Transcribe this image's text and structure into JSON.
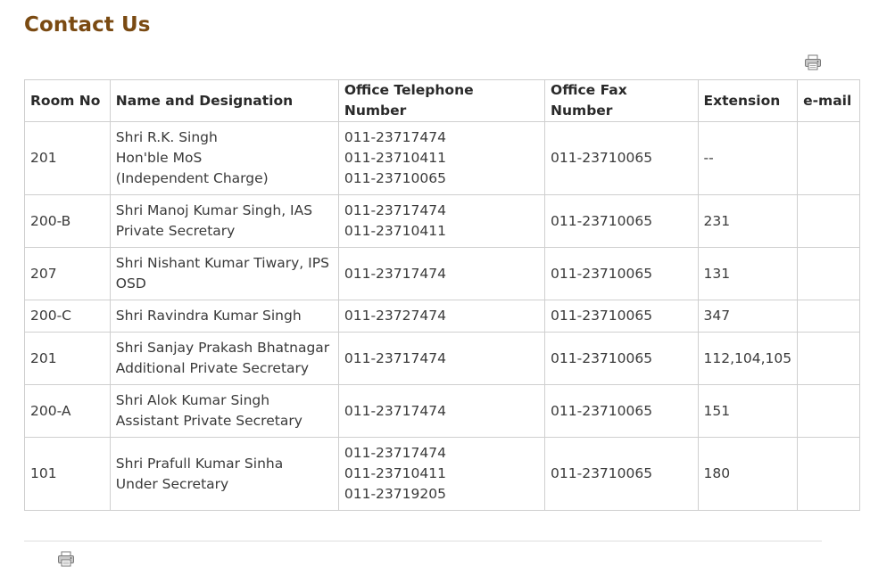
{
  "page": {
    "title": "Contact Us"
  },
  "icons": {
    "print_top": "print-icon",
    "print_bottom": "print-icon"
  },
  "table": {
    "headers": [
      "Room No",
      "Name and Designation",
      "Office Telephone Number",
      "Office Fax Number",
      "Extension",
      "e-mail"
    ],
    "rows": [
      {
        "room": "201",
        "name_lines": [
          "Shri R.K. Singh",
          "Hon'ble MoS",
          "(Independent Charge)"
        ],
        "phones": [
          "011-23717474",
          "011-23710411",
          "011-23710065"
        ],
        "fax": "011-23710065",
        "extension": "--",
        "email": ""
      },
      {
        "room": "200-B",
        "name_lines": [
          "Shri Manoj Kumar Singh, IAS",
          "Private Secretary"
        ],
        "phones": [
          "011-23717474",
          "011-23710411"
        ],
        "fax": "011-23710065",
        "extension": "231",
        "email": ""
      },
      {
        "room": "207",
        "name_lines": [
          "Shri Nishant Kumar Tiwary, IPS",
          "OSD"
        ],
        "phones": [
          "011-23717474"
        ],
        "fax": "011-23710065",
        "extension": "131",
        "email": ""
      },
      {
        "room": "200-C",
        "name_lines": [
          "Shri Ravindra Kumar Singh"
        ],
        "phones": [
          "011-23727474"
        ],
        "fax": "011-23710065",
        "extension": "347",
        "email": ""
      },
      {
        "room": "201",
        "name_lines": [
          "Shri Sanjay Prakash Bhatnagar",
          "Additional Private Secretary"
        ],
        "phones": [
          "011-23717474"
        ],
        "fax": "011-23710065",
        "extension": "112,104,105",
        "email": ""
      },
      {
        "room": "200-A",
        "name_lines": [
          "Shri Alok Kumar Singh",
          "Assistant Private Secretary"
        ],
        "phones": [
          "011-23717474"
        ],
        "fax": "011-23710065",
        "extension": "151",
        "email": ""
      },
      {
        "room": "101",
        "name_lines": [
          "Shri Prafull Kumar Sinha",
          "Under Secretary"
        ],
        "phones": [
          "011-23717474",
          "011-23710411",
          "011-23719205"
        ],
        "fax": "011-23710065",
        "extension": "180",
        "email": ""
      }
    ]
  }
}
